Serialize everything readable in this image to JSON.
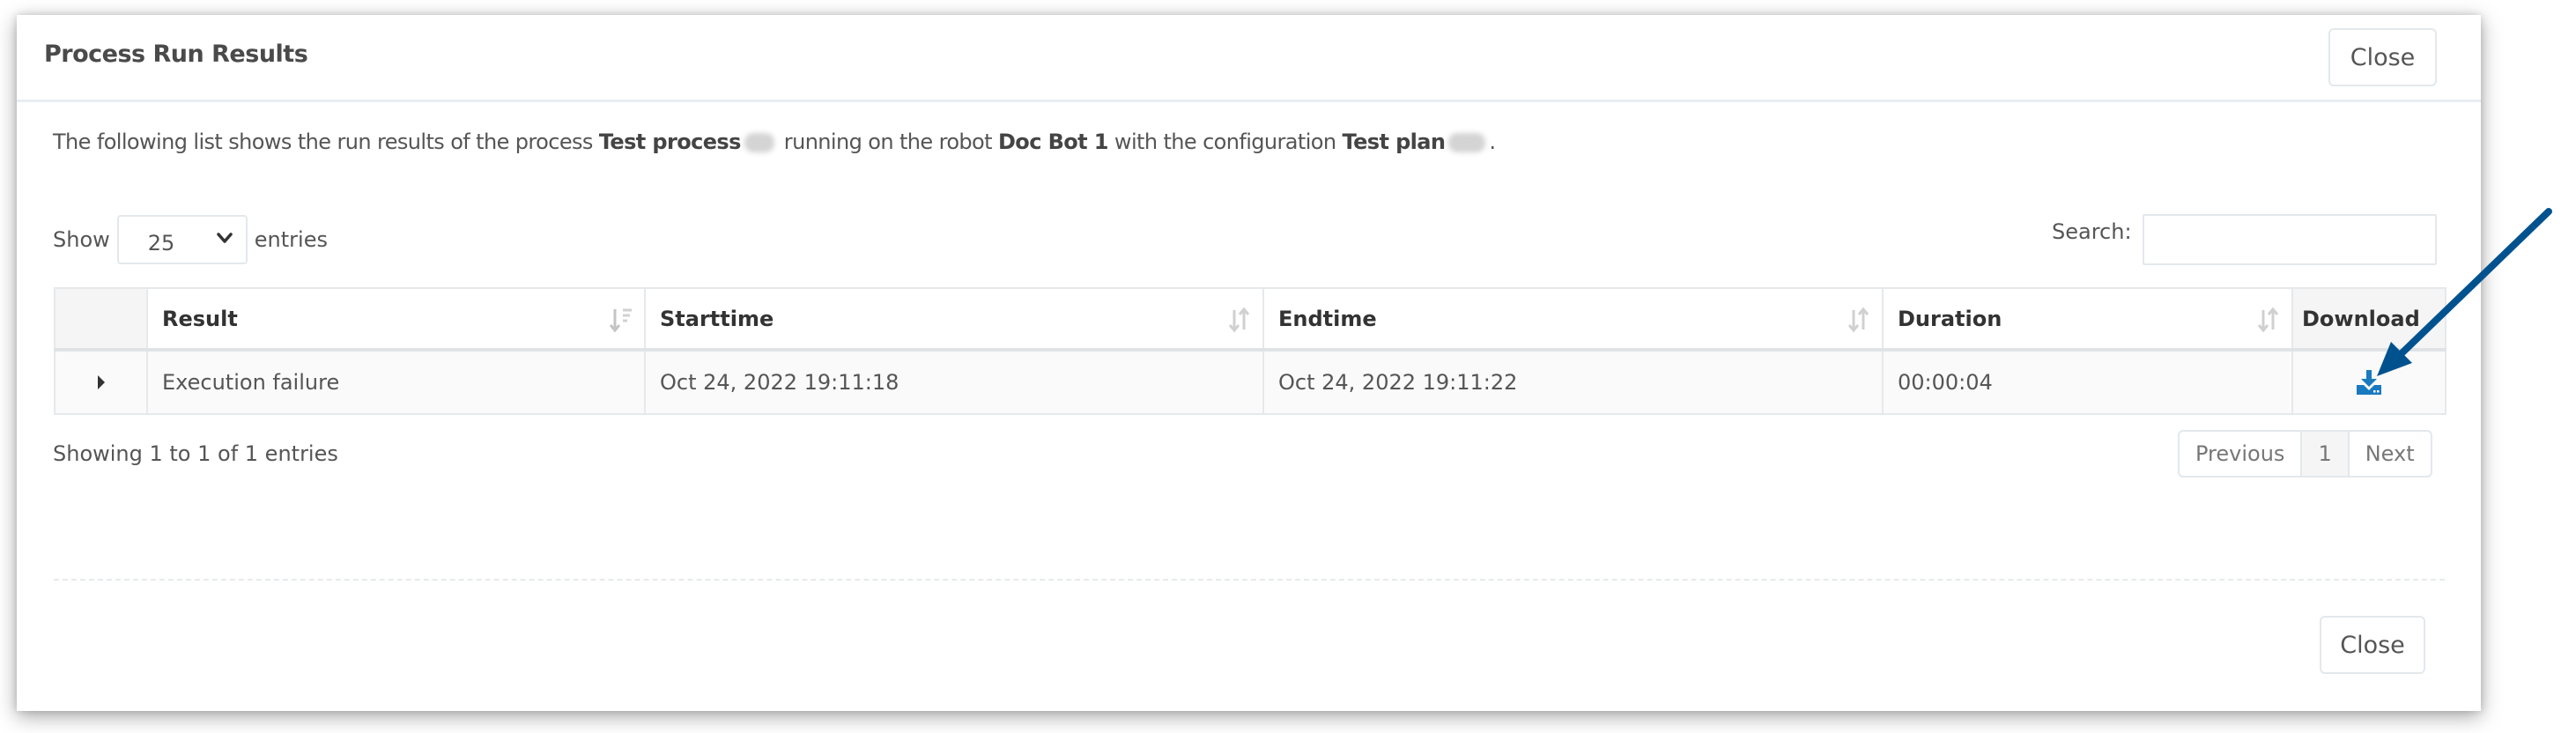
{
  "dialog": {
    "title": "Process Run Results",
    "close_label": "Close",
    "footer_close_label": "Close",
    "description": {
      "prefix": "The following list shows the run results of the process ",
      "process_name": "Test process",
      "middle": " running on the robot ",
      "robot_name": "Doc Bot 1",
      "config_text": " with the configuration ",
      "config_name": "Test plan",
      "suffix": "."
    }
  },
  "table_controls": {
    "show_label": "Show",
    "entries_label": "entries",
    "page_size": "25",
    "search_label": "Search:",
    "search_value": ""
  },
  "table": {
    "columns": [
      {
        "label": ""
      },
      {
        "label": "Result",
        "sort": "sorted-desc"
      },
      {
        "label": "Starttime",
        "sort": "sortable"
      },
      {
        "label": "Endtime",
        "sort": "sortable"
      },
      {
        "label": "Duration",
        "sort": "sortable"
      },
      {
        "label": "Download"
      }
    ],
    "rows": [
      {
        "result": "Execution failure",
        "starttime": "Oct 24, 2022 19:11:18",
        "endtime": "Oct 24, 2022 19:11:22",
        "duration": "00:00:04",
        "download_icon": "download-icon"
      }
    ]
  },
  "footer": {
    "info": "Showing 1 to 1 of 1 entries",
    "pagination": {
      "previous": "Previous",
      "current": "1",
      "next": "Next"
    }
  },
  "colors": {
    "error_text": "#f2354f",
    "download_icon": "#1a7ac0",
    "annotation_arrow": "#00528f"
  }
}
